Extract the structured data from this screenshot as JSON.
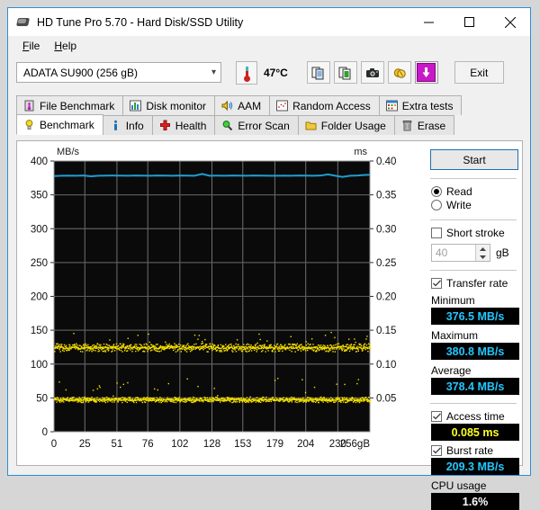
{
  "window": {
    "title": "HD Tune Pro 5.70 - Hard Disk/SSD Utility",
    "icon": "hard-disk-icon",
    "minimize": "–",
    "maximize": "□",
    "close": "✕"
  },
  "menu": {
    "items": [
      {
        "label": "File",
        "accel": "F"
      },
      {
        "label": "Help",
        "accel": "H"
      }
    ]
  },
  "toolbar": {
    "drive": "ADATA SU900 (256 gB)",
    "drive_chevron": "∨",
    "temperature": "47°C",
    "thermometer_icon": "thermometer-icon",
    "buttons": [
      {
        "name": "copy-icon",
        "label": ""
      },
      {
        "name": "copy-sheet-icon",
        "label": ""
      },
      {
        "name": "camera-icon",
        "label": ""
      },
      {
        "name": "coins-icon",
        "label": ""
      },
      {
        "name": "download-icon",
        "label": ""
      }
    ],
    "exit_label": "Exit"
  },
  "tabs": {
    "row1": [
      {
        "label": "File Benchmark",
        "icon": "thermometer-flask-icon",
        "active": false
      },
      {
        "label": "Disk monitor",
        "icon": "bar-chart-icon",
        "active": false
      },
      {
        "label": "AAM",
        "icon": "speaker-icon",
        "active": false
      },
      {
        "label": "Random Access",
        "icon": "scatter-icon",
        "active": false
      },
      {
        "label": "Extra tests",
        "icon": "grid-icon",
        "active": false
      }
    ],
    "row2": [
      {
        "label": "Benchmark",
        "icon": "lightbulb-icon",
        "active": true
      },
      {
        "label": "Info",
        "icon": "info-icon",
        "active": false
      },
      {
        "label": "Health",
        "icon": "cross-icon",
        "active": false
      },
      {
        "label": "Error Scan",
        "icon": "magnifier-icon",
        "active": false
      },
      {
        "label": "Folder Usage",
        "icon": "folder-icon",
        "active": false
      },
      {
        "label": "Erase",
        "icon": "trash-icon",
        "active": false
      }
    ]
  },
  "sidebar": {
    "start_label": "Start",
    "mode_read": "Read",
    "mode_write": "Write",
    "mode_selected": "Read",
    "short_stroke_label": "Short stroke",
    "short_stroke_checked": false,
    "short_stroke_value": "40",
    "short_stroke_unit": "gB",
    "transfer_rate_label": "Transfer rate",
    "transfer_rate_checked": true,
    "minimum_label": "Minimum",
    "minimum_value": "376.5 MB/s",
    "maximum_label": "Maximum",
    "maximum_value": "380.8 MB/s",
    "average_label": "Average",
    "average_value": "378.4 MB/s",
    "access_time_label": "Access time",
    "access_time_checked": true,
    "access_time_value": "0.085 ms",
    "burst_rate_label": "Burst rate",
    "burst_rate_checked": true,
    "burst_rate_value": "209.3 MB/s",
    "cpu_usage_label": "CPU usage",
    "cpu_usage_value": "1.6%"
  },
  "chart_data": {
    "type": "line",
    "title": "",
    "xlabel": "",
    "ylabel": "MB/s",
    "y2label": "ms",
    "xlim": [
      0,
      256
    ],
    "ylim": [
      0,
      400
    ],
    "y2lim": [
      0.0,
      0.4
    ],
    "grid": true,
    "legend": "none",
    "plot_bg": "#0a0a0a",
    "grid_color": "#707070",
    "xticks": [
      "0",
      "25",
      "51",
      "76",
      "102",
      "128",
      "153",
      "179",
      "204",
      "230",
      "256gB"
    ],
    "xtick_values": [
      0,
      25,
      51,
      76,
      102,
      128,
      153,
      179,
      204,
      230,
      256
    ],
    "yticks": [
      "0",
      "50",
      "100",
      "150",
      "200",
      "250",
      "300",
      "350",
      "400"
    ],
    "ytick_values": [
      0,
      50,
      100,
      150,
      200,
      250,
      300,
      350,
      400
    ],
    "y2ticks": [
      "0.05",
      "0.10",
      "0.15",
      "0.20",
      "0.25",
      "0.30",
      "0.35",
      "0.40"
    ],
    "y2tick_values": [
      0.05,
      0.1,
      0.15,
      0.2,
      0.25,
      0.3,
      0.35,
      0.4
    ],
    "series": [
      {
        "name": "Transfer rate",
        "type": "line",
        "color": "#1f9ed0",
        "axis": "left",
        "unit": "MB/s",
        "x": [
          0,
          6,
          12,
          18,
          24,
          30,
          36,
          42,
          48,
          54,
          60,
          66,
          72,
          78,
          84,
          90,
          96,
          102,
          108,
          114,
          120,
          126,
          132,
          138,
          144,
          150,
          156,
          162,
          168,
          174,
          180,
          186,
          192,
          198,
          204,
          210,
          216,
          222,
          228,
          234,
          240,
          246,
          252,
          256
        ],
        "values": [
          377.8,
          378.2,
          378.4,
          378.3,
          378.5,
          377.4,
          378.3,
          378.4,
          378.5,
          378.4,
          378.3,
          378.5,
          378.4,
          378.3,
          378.5,
          378.4,
          378.3,
          378.5,
          378.4,
          378.2,
          380.8,
          378.3,
          378.4,
          378.3,
          378.5,
          378.4,
          378.3,
          378.5,
          378.4,
          378.3,
          378.2,
          378.4,
          378.3,
          378.5,
          378.4,
          378.3,
          378.5,
          380.2,
          378.2,
          376.5,
          378.3,
          378.6,
          379.4,
          379.6
        ]
      },
      {
        "name": "Access time (upper band)",
        "type": "scatter",
        "color": "#f5e000",
        "axis": "right",
        "unit": "ms",
        "band_center": 0.125,
        "band_spread": 0.006,
        "outlier_max": 0.148
      },
      {
        "name": "Access time (lower band)",
        "type": "scatter",
        "color": "#f5e000",
        "axis": "right",
        "unit": "ms",
        "band_center": 0.048,
        "band_spread": 0.004,
        "outlier_max": 0.082
      }
    ]
  }
}
